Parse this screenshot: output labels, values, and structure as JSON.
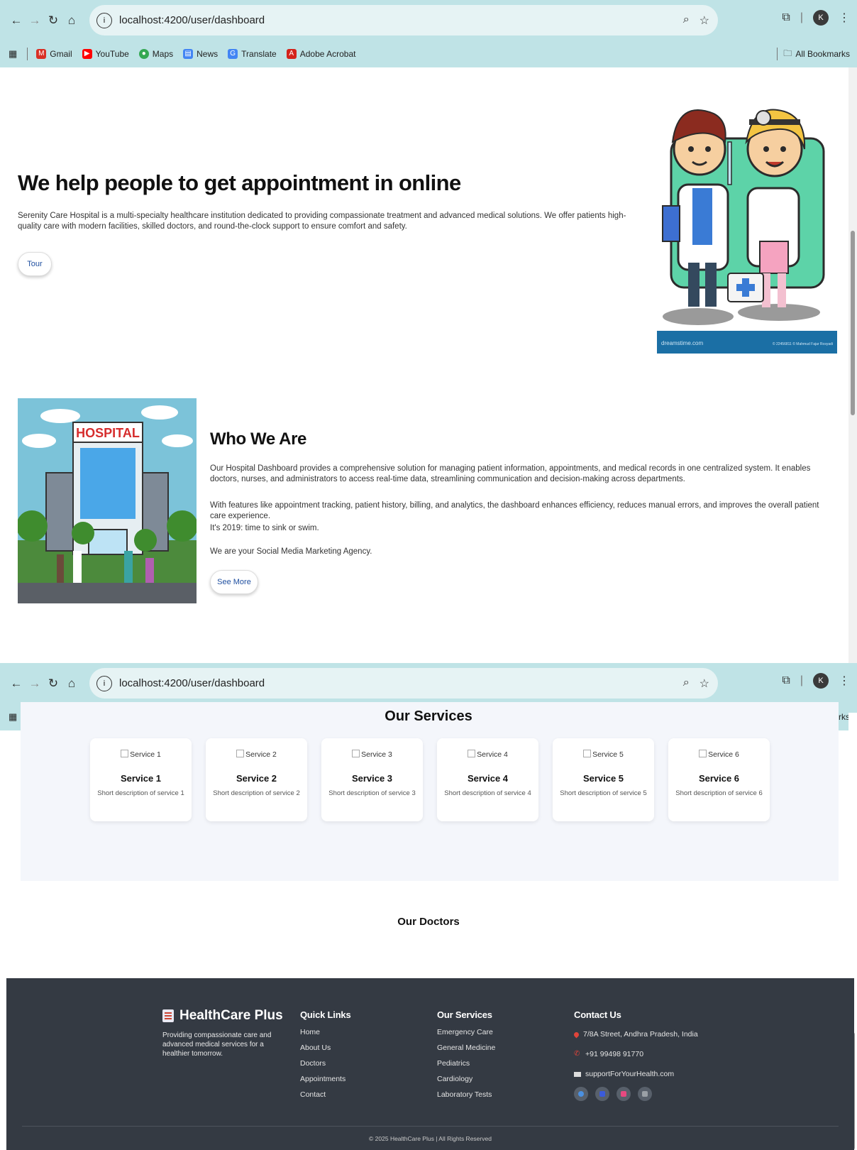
{
  "browser": {
    "url": "localhost:4200/user/dashboard",
    "profile_initial": "K",
    "bookmarks": [
      {
        "label": "Gmail",
        "icon": "gmail-icon",
        "color": "#d93025"
      },
      {
        "label": "YouTube",
        "icon": "youtube-icon",
        "color": "#ff0000"
      },
      {
        "label": "Maps",
        "icon": "maps-icon",
        "color": "#34a853"
      },
      {
        "label": "News",
        "icon": "news-icon",
        "color": "#4285f4"
      },
      {
        "label": "Translate",
        "icon": "translate-icon",
        "color": "#4285f4"
      },
      {
        "label": "Adobe Acrobat",
        "icon": "acrobat-icon",
        "color": "#d4231b"
      }
    ],
    "all_bookmarks": "All Bookmarks"
  },
  "hero": {
    "title": "We help people to get appointment in online",
    "text": "Serenity Care Hospital is a multi-specialty healthcare institution dedicated to providing compassionate treatment and advanced medical solutions. We offer patients high-quality care with modern facilities, skilled doctors, and round-the-clock support to ensure comfort and safety.",
    "button": "Tour",
    "image_footer_left": "dreamstime.com",
    "image_footer_right": "© 22456811 © Mahmud Fajar Rosyadi"
  },
  "who": {
    "title": "Who We Are",
    "p1": "Our Hospital Dashboard provides a comprehensive solution for managing patient information, appointments, and medical records in one centralized system. It enables doctors, nurses, and administrators to access real-time data, streamlining communication and decision-making across departments.",
    "p2": "With features like appointment tracking, patient history, billing, and analytics, the dashboard enhances efficiency, reduces manual errors, and improves the overall patient care experience.",
    "p3": "It's 2019: time to sink or swim.",
    "p4": "We are your Social Media Marketing Agency.",
    "button": "See More",
    "image_sign": "HOSPITAL"
  },
  "services": {
    "title": "Our Services",
    "items": [
      {
        "alt": "Service 1",
        "name": "Service 1",
        "desc": "Short description of service 1"
      },
      {
        "alt": "Service 2",
        "name": "Service 2",
        "desc": "Short description of service 2"
      },
      {
        "alt": "Service 3",
        "name": "Service 3",
        "desc": "Short description of service 3"
      },
      {
        "alt": "Service 4",
        "name": "Service 4",
        "desc": "Short description of service 4"
      },
      {
        "alt": "Service 5",
        "name": "Service 5",
        "desc": "Short description of service 5"
      },
      {
        "alt": "Service 6",
        "name": "Service 6",
        "desc": "Short description of service 6"
      }
    ]
  },
  "doctors": {
    "title": "Our Doctors"
  },
  "footer": {
    "brand": "HealthCare Plus",
    "tagline": "Providing compassionate care and advanced medical services for a healthier tomorrow.",
    "quick_links": {
      "title": "Quick Links",
      "items": [
        "Home",
        "About Us",
        "Doctors",
        "Appointments",
        "Contact"
      ]
    },
    "our_services": {
      "title": "Our Services",
      "items": [
        "Emergency Care",
        "General Medicine",
        "Pediatrics",
        "Cardiology",
        "Laboratory Tests"
      ]
    },
    "contact": {
      "title": "Contact Us",
      "address": "7/8A Street, Andhra Pradesh, India",
      "phone": "+91 99498 91770",
      "email": "supportForYourHealth.com"
    },
    "social_colors": [
      "#4a90e2",
      "#3b5bdb",
      "#e64980",
      "#9aa0a6"
    ],
    "copyright": "© 2025 HealthCare Plus | All Rights Reserved"
  }
}
